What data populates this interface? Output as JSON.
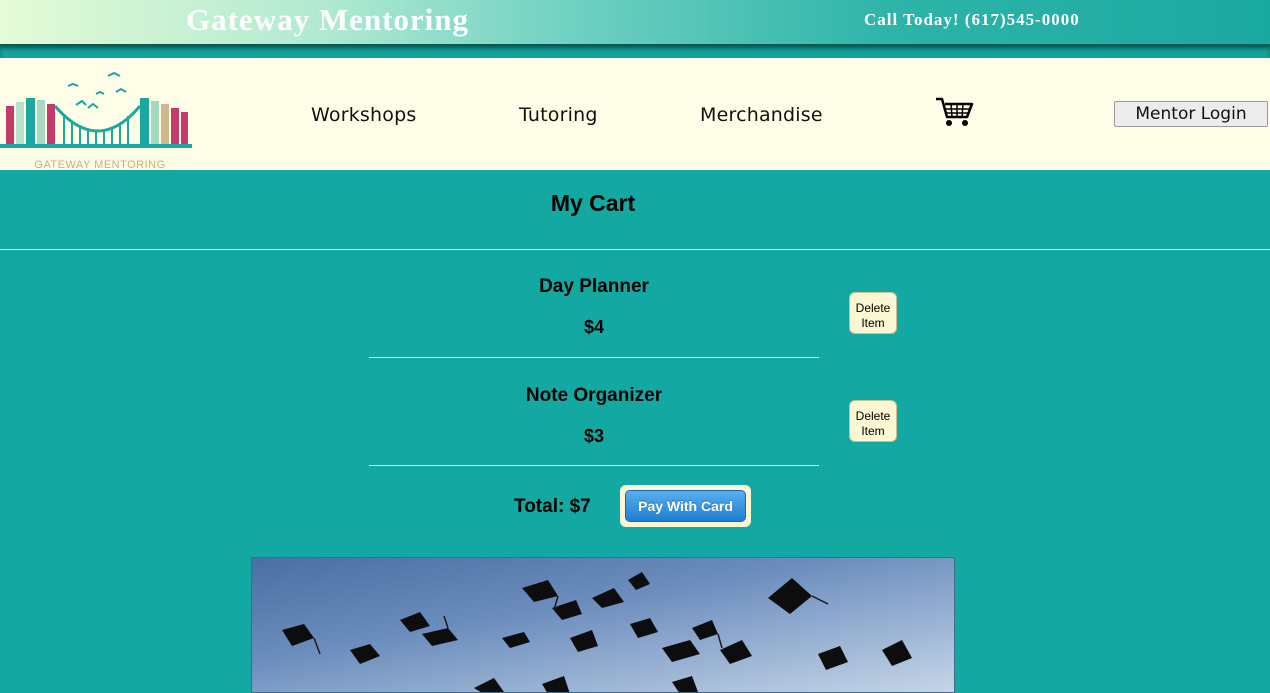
{
  "header": {
    "brand_title": "Gateway Mentoring",
    "phone_text": "Call Today! (617)545-0000"
  },
  "nav": {
    "logo_text": "GATEWAY MENTORING",
    "links": [
      "Workshops",
      "Tutoring",
      "Merchandise"
    ],
    "cart_icon": "shopping-cart-icon",
    "login_label": "Mentor Login"
  },
  "cart": {
    "title": "My Cart",
    "items": [
      {
        "name": "Day Planner",
        "price": "$4",
        "delete_label_1": "Delete",
        "delete_label_2": "Item"
      },
      {
        "name": "Note Organizer",
        "price": "$3",
        "delete_label_1": "Delete",
        "delete_label_2": "Item"
      }
    ],
    "total": "Total: $7",
    "pay_label": "Pay With Card"
  },
  "colors": {
    "background": "#13a9a2",
    "navbar": "#fefee8",
    "button_cream": "#fbf7d2",
    "pay_blue": "#1f7fd1"
  },
  "hero": {
    "icon": "graduation-caps-image"
  }
}
